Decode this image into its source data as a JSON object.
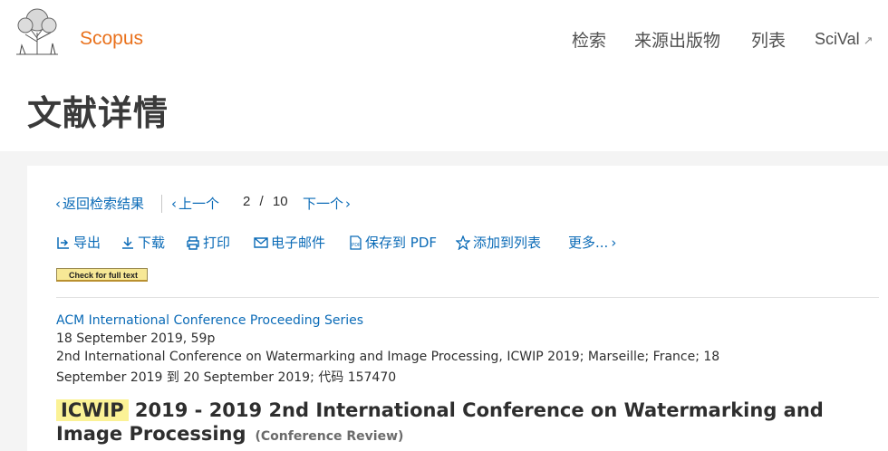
{
  "header": {
    "brand": "Scopus",
    "nav": {
      "search": "检索",
      "sources": "来源出版物",
      "lists": "列表",
      "scival": "SciVal"
    }
  },
  "page_title": "文献详情",
  "pager": {
    "back_label": "返回检索结果",
    "prev_label": "上一个",
    "current": "2",
    "separator": "/",
    "total": "10",
    "next_label": "下一个"
  },
  "actions": {
    "export": "导出",
    "download": "下载",
    "print": "打印",
    "email": "电子邮件",
    "save_pdf": "保存到 PDF",
    "add_to_list": "添加到列表",
    "more": "更多..."
  },
  "check_full_text": "Check for full text",
  "document": {
    "series": "ACM International Conference Proceeding Series",
    "date_pages": "18 September 2019, 59p",
    "conference_line1": "2nd International Conference on Watermarking and Image Processing, ICWIP 2019; Marseille; France; 18",
    "conference_line2": "September 2019 到 20 September 2019; 代码 157470",
    "title_highlight": "ICWIP",
    "title_rest": " 2019 - 2019 2nd International Conference on Watermarking and Image Processing",
    "doc_type": "(Conference Review)"
  },
  "colors": {
    "brand_orange": "#e9711c",
    "link_blue": "#0b6bb7",
    "highlight": "#fbf296"
  }
}
